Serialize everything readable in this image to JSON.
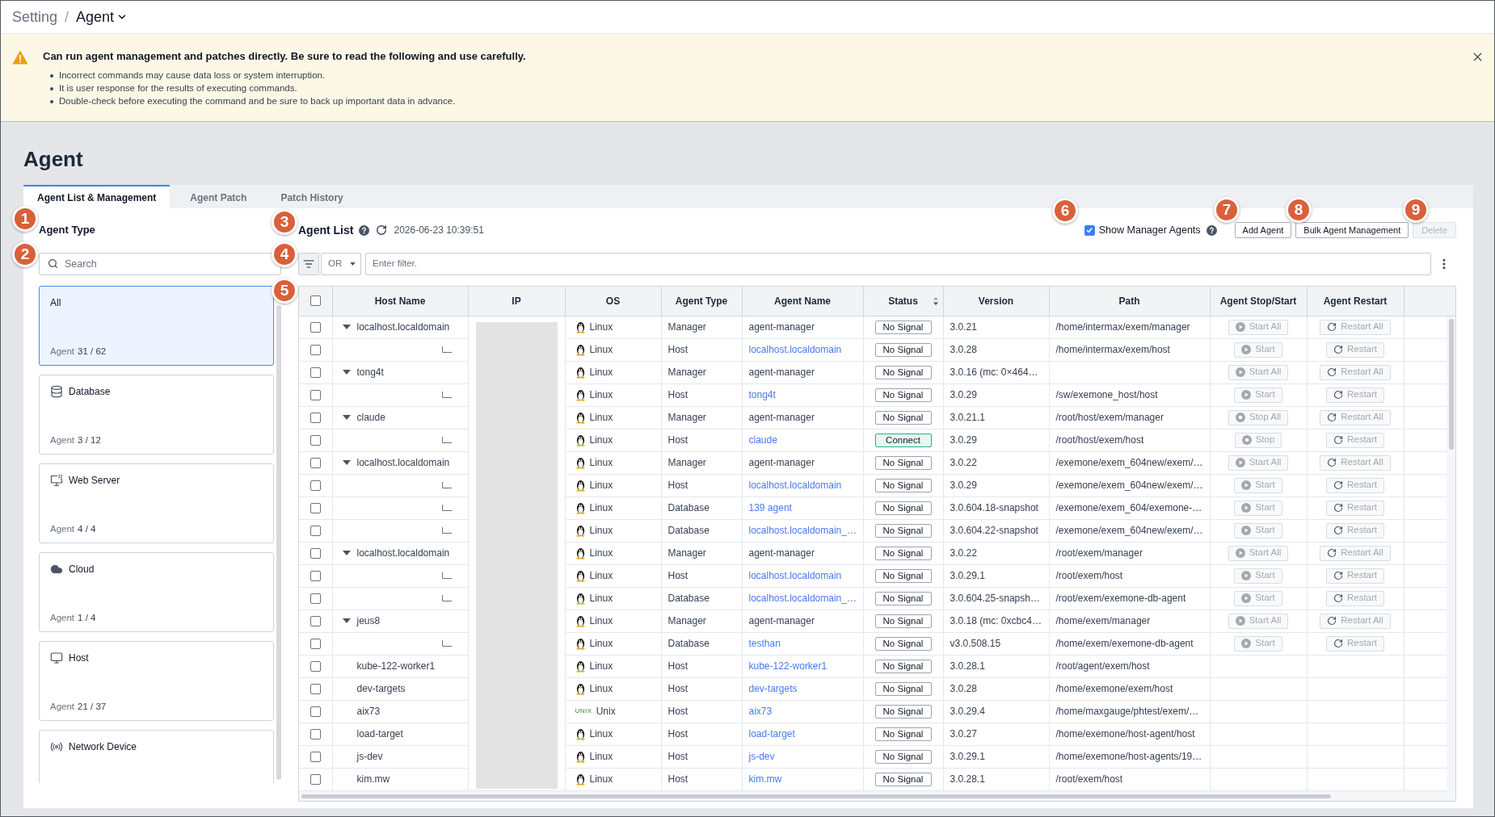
{
  "breadcrumb": {
    "separator": "/",
    "items": [
      {
        "label": "Setting",
        "current": false
      },
      {
        "label": "Agent",
        "current": true
      }
    ]
  },
  "alert": {
    "title": "Can run agent management and patches directly. Be sure to read the following and use carefully.",
    "items": [
      "Incorrect commands may cause data loss or system interruption.",
      "It is user response for the results of executing commands.",
      "Double-check before executing the command and be sure to back up important data in advance."
    ],
    "dismissible": true
  },
  "page": {
    "title": "Agent"
  },
  "tabs": [
    {
      "label": "Agent List & Management",
      "selected": true
    },
    {
      "label": "Agent Patch",
      "selected": false
    },
    {
      "label": "Patch History",
      "selected": false
    }
  ],
  "sidebar": {
    "title": "Agent Type",
    "search": {
      "placeholder": "Search"
    },
    "items": [
      {
        "kind": "all",
        "label": "All",
        "count_label": "Agent",
        "count": "31 / 62",
        "selected": true
      },
      {
        "kind": "database",
        "label": "Database",
        "count_label": "Agent",
        "count": "3 / 12",
        "selected": false
      },
      {
        "kind": "web_server",
        "label": "Web Server",
        "count_label": "Agent",
        "count": "4 / 4",
        "selected": false
      },
      {
        "kind": "cloud",
        "label": "Cloud",
        "count_label": "Agent",
        "count": "1 / 4",
        "selected": false
      },
      {
        "kind": "host",
        "label": "Host",
        "count_label": "Agent",
        "count": "21 / 37",
        "selected": false
      },
      {
        "kind": "network",
        "label": "Network Device",
        "selected": false
      }
    ]
  },
  "agent_list": {
    "title": "Agent List",
    "updated": "2026-06-23 10:39:51",
    "show_manager_agents": {
      "label": "Show Manager Agents",
      "checked": true
    },
    "buttons": [
      {
        "label": "Add Agent",
        "disabled": false
      },
      {
        "label": "Bulk Agent Management",
        "disabled": false
      },
      {
        "label": "Delete",
        "disabled": true
      }
    ],
    "filter": {
      "operator": "OR",
      "placeholder": "Enter filter."
    }
  },
  "table": {
    "select_all_checked": false,
    "columns": [
      {
        "label": "Host Name",
        "sortable": false
      },
      {
        "label": "IP",
        "sortable": false
      },
      {
        "label": "OS",
        "sortable": false
      },
      {
        "label": "Agent Type",
        "sortable": false
      },
      {
        "label": "Agent Name",
        "sortable": false
      },
      {
        "label": "Status",
        "sortable": true
      },
      {
        "label": "Version",
        "sortable": false
      },
      {
        "label": "Path",
        "sortable": false
      },
      {
        "label": "Agent Stop/Start",
        "sortable": false
      },
      {
        "label": "Agent Restart",
        "sortable": false
      }
    ],
    "rows": [
      {
        "kind": "manager",
        "checked": false,
        "host_name": "localhost.localdomain",
        "expanded": true,
        "os": {
          "kind": "linux",
          "name": "Linux"
        },
        "agent_type": "Manager",
        "agent_name": "agent-manager",
        "status": {
          "kind": "no_signal",
          "label": "No Signal"
        },
        "version": "3.0.21",
        "path": "/home/intermax/exem/manager",
        "actions": [
          {
            "kind": "start",
            "label": "Start All",
            "disabled": true
          },
          {
            "kind": "restart",
            "label": "Restart All",
            "disabled": true
          }
        ],
        "children": [
          {
            "kind": "agent",
            "checked": false,
            "os": {
              "kind": "linux",
              "name": "Linux"
            },
            "agent_type": "Host",
            "agent_name": "localhost.localdomain",
            "status": {
              "kind": "no_signal",
              "label": "No Signal"
            },
            "version": "3.0.28",
            "path": "/home/intermax/exem/host",
            "actions": [
              {
                "kind": "start",
                "label": "Start",
                "disabled": true
              },
              {
                "kind": "restart",
                "label": "Restart",
                "disabled": true
              }
            ]
          }
        ]
      },
      {
        "kind": "manager",
        "checked": false,
        "host_name": "tong4t",
        "expanded": true,
        "os": {
          "kind": "linux",
          "name": "Linux"
        },
        "agent_type": "Manager",
        "agent_name": "agent-manager",
        "status": {
          "kind": "no_signal",
          "label": "No Signal"
        },
        "version": "3.0.16 (mc: 0×464…",
        "actions": [
          {
            "kind": "start",
            "label": "Start All",
            "disabled": true
          },
          {
            "kind": "restart",
            "label": "Restart All",
            "disabled": true
          }
        ],
        "children": [
          {
            "kind": "agent",
            "checked": false,
            "os": {
              "kind": "linux",
              "name": "Linux"
            },
            "agent_type": "Host",
            "agent_name": "tong4t",
            "status": {
              "kind": "no_signal",
              "label": "No Signal"
            },
            "version": "3.0.29",
            "path": "/sw/exemone_host/host",
            "actions": [
              {
                "kind": "start",
                "label": "Start",
                "disabled": true
              },
              {
                "kind": "restart",
                "label": "Restart",
                "disabled": true
              }
            ]
          }
        ]
      },
      {
        "kind": "manager",
        "checked": false,
        "host_name": "claude",
        "expanded": true,
        "os": {
          "kind": "linux",
          "name": "Linux"
        },
        "agent_type": "Manager",
        "agent_name": "agent-manager",
        "status": {
          "kind": "no_signal",
          "label": "No Signal"
        },
        "version": "3.0.21.1",
        "path": "/root/host/exem/manager",
        "actions": [
          {
            "kind": "stop",
            "label": "Stop All",
            "disabled": true
          },
          {
            "kind": "restart",
            "label": "Restart All",
            "disabled": true
          }
        ],
        "children": [
          {
            "kind": "agent",
            "checked": false,
            "os": {
              "kind": "linux",
              "name": "Linux"
            },
            "agent_type": "Host",
            "agent_name": "claude",
            "status": {
              "kind": "connected",
              "label": "Connect"
            },
            "version": "3.0.29",
            "path": "/root/host/exem/host",
            "actions": [
              {
                "kind": "stop",
                "label": "Stop",
                "disabled": true
              },
              {
                "kind": "restart",
                "label": "Restart",
                "disabled": true
              }
            ]
          }
        ]
      },
      {
        "kind": "manager",
        "checked": false,
        "host_name": "localhost.localdomain",
        "expanded": true,
        "os": {
          "kind": "linux",
          "name": "Linux"
        },
        "agent_type": "Manager",
        "agent_name": "agent-manager",
        "status": {
          "kind": "no_signal",
          "label": "No Signal"
        },
        "version": "3.0.22",
        "path": "/exemone/exem_604new/exem/…",
        "actions": [
          {
            "kind": "start",
            "label": "Start All",
            "disabled": true
          },
          {
            "kind": "restart",
            "label": "Restart All",
            "disabled": true
          }
        ],
        "children": [
          {
            "kind": "agent",
            "checked": false,
            "os": {
              "kind": "linux",
              "name": "Linux"
            },
            "agent_type": "Host",
            "agent_name": "localhost.localdomain",
            "status": {
              "kind": "no_signal",
              "label": "No Signal"
            },
            "version": "3.0.29",
            "path": "/exemone/exem_604new/exem/…",
            "actions": [
              {
                "kind": "start",
                "label": "Start",
                "disabled": true
              },
              {
                "kind": "restart",
                "label": "Restart",
                "disabled": true
              }
            ]
          },
          {
            "kind": "agent",
            "checked": false,
            "os": {
              "kind": "linux",
              "name": "Linux"
            },
            "agent_type": "Database",
            "agent_name": "139 agent",
            "status": {
              "kind": "no_signal",
              "label": "No Signal"
            },
            "version": "3.0.604.18-snapshot",
            "path": "/exemone/exem_604/exemone-…",
            "actions": [
              {
                "kind": "start",
                "label": "Start",
                "disabled": true
              },
              {
                "kind": "restart",
                "label": "Restart",
                "disabled": true
              }
            ]
          },
          {
            "kind": "agent",
            "checked": false,
            "os": {
              "kind": "linux",
              "name": "Linux"
            },
            "agent_type": "Database",
            "agent_name": "localhost.localdomain_…",
            "status": {
              "kind": "no_signal",
              "label": "No Signal"
            },
            "version": "3.0.604.22-snapshot",
            "path": "/exemone/exem_604new/exem/…",
            "actions": [
              {
                "kind": "start",
                "label": "Start",
                "disabled": true
              },
              {
                "kind": "restart",
                "label": "Restart",
                "disabled": true
              }
            ]
          }
        ]
      },
      {
        "kind": "manager",
        "checked": false,
        "host_name": "localhost.localdomain",
        "expanded": true,
        "os": {
          "kind": "linux",
          "name": "Linux"
        },
        "agent_type": "Manager",
        "agent_name": "agent-manager",
        "status": {
          "kind": "no_signal",
          "label": "No Signal"
        },
        "version": "3.0.22",
        "path": "/root/exem/manager",
        "actions": [
          {
            "kind": "start",
            "label": "Start All",
            "disabled": true
          },
          {
            "kind": "restart",
            "label": "Restart All",
            "disabled": true
          }
        ],
        "children": [
          {
            "kind": "agent",
            "checked": false,
            "os": {
              "kind": "linux",
              "name": "Linux"
            },
            "agent_type": "Host",
            "agent_name": "localhost.localdomain",
            "status": {
              "kind": "no_signal",
              "label": "No Signal"
            },
            "version": "3.0.29.1",
            "path": "/root/exem/host",
            "actions": [
              {
                "kind": "start",
                "label": "Start",
                "disabled": true
              },
              {
                "kind": "restart",
                "label": "Restart",
                "disabled": true
              }
            ]
          },
          {
            "kind": "agent",
            "checked": false,
            "os": {
              "kind": "linux",
              "name": "Linux"
            },
            "agent_type": "Database",
            "agent_name": "localhost.localdomain_…",
            "status": {
              "kind": "no_signal",
              "label": "No Signal"
            },
            "version": "3.0.604.25-snapsh…",
            "path": "/root/exem/exemone-db-agent",
            "actions": [
              {
                "kind": "start",
                "label": "Start",
                "disabled": true
              },
              {
                "kind": "restart",
                "label": "Restart",
                "disabled": true
              }
            ]
          }
        ]
      },
      {
        "kind": "manager",
        "checked": false,
        "host_name": "jeus8",
        "expanded": true,
        "os": {
          "kind": "linux",
          "name": "Linux"
        },
        "agent_type": "Manager",
        "agent_name": "agent-manager",
        "status": {
          "kind": "no_signal",
          "label": "No Signal"
        },
        "version": "3.0.18 (mc: 0xcbc4…",
        "path": "/home/exem/manager",
        "actions": [
          {
            "kind": "start",
            "label": "Start All",
            "disabled": true
          },
          {
            "kind": "restart",
            "label": "Restart All",
            "disabled": true
          }
        ],
        "children": [
          {
            "kind": "agent",
            "checked": false,
            "os": {
              "kind": "linux",
              "name": "Linux"
            },
            "agent_type": "Database",
            "agent_name": "testhan",
            "status": {
              "kind": "no_signal",
              "label": "No Signal"
            },
            "version": "v3.0.508.15",
            "path": "/home/exem/exemone-db-agent",
            "actions": [
              {
                "kind": "start",
                "label": "Start",
                "disabled": true
              },
              {
                "kind": "restart",
                "label": "Restart",
                "disabled": true
              }
            ]
          }
        ]
      },
      {
        "kind": "agent",
        "checked": false,
        "host_name": "kube-122-worker1",
        "os": {
          "kind": "linux",
          "name": "Linux"
        },
        "agent_type": "Host",
        "agent_name": "kube-122-worker1",
        "status": {
          "kind": "no_signal",
          "label": "No Signal"
        },
        "version": "3.0.28.1",
        "path": "/root/agent/exem/host"
      },
      {
        "kind": "agent",
        "checked": false,
        "host_name": "dev-targets",
        "os": {
          "kind": "linux",
          "name": "Linux"
        },
        "agent_type": "Host",
        "agent_name": "dev-targets",
        "status": {
          "kind": "no_signal",
          "label": "No Signal"
        },
        "version": "3.0.28",
        "path": "/home/exemone/exem/host"
      },
      {
        "kind": "agent",
        "checked": false,
        "host_name": "aix73",
        "os": {
          "kind": "unix",
          "logo": "UNIX",
          "name": "Unix"
        },
        "agent_type": "Host",
        "agent_name": "aix73",
        "status": {
          "kind": "no_signal",
          "label": "No Signal"
        },
        "version": "3.0.29.4",
        "path": "/home/maxgauge/phtest/exem/…"
      },
      {
        "kind": "agent",
        "checked": false,
        "host_name": "load-target",
        "os": {
          "kind": "linux",
          "name": "Linux"
        },
        "agent_type": "Host",
        "agent_name": "load-target",
        "status": {
          "kind": "no_signal",
          "label": "No Signal"
        },
        "version": "3.0.27",
        "path": "/home/exemone/host-agent/host"
      },
      {
        "kind": "agent",
        "checked": false,
        "host_name": "js-dev",
        "os": {
          "kind": "linux",
          "name": "Linux"
        },
        "agent_type": "Host",
        "agent_name": "js-dev",
        "status": {
          "kind": "no_signal",
          "label": "No Signal"
        },
        "version": "3.0.29.1",
        "path": "/home/exemone/host-agents/19…"
      },
      {
        "kind": "agent",
        "checked": false,
        "host_name": "kim.mw",
        "os": {
          "kind": "linux",
          "name": "Linux"
        },
        "agent_type": "Host",
        "agent_name": "kim.mw",
        "status": {
          "kind": "no_signal",
          "label": "No Signal"
        },
        "version": "3.0.28.1",
        "path": "/root/exem/host"
      }
    ]
  },
  "callouts": [
    "1",
    "2",
    "3",
    "4",
    "5",
    "6",
    "7",
    "8",
    "9"
  ]
}
